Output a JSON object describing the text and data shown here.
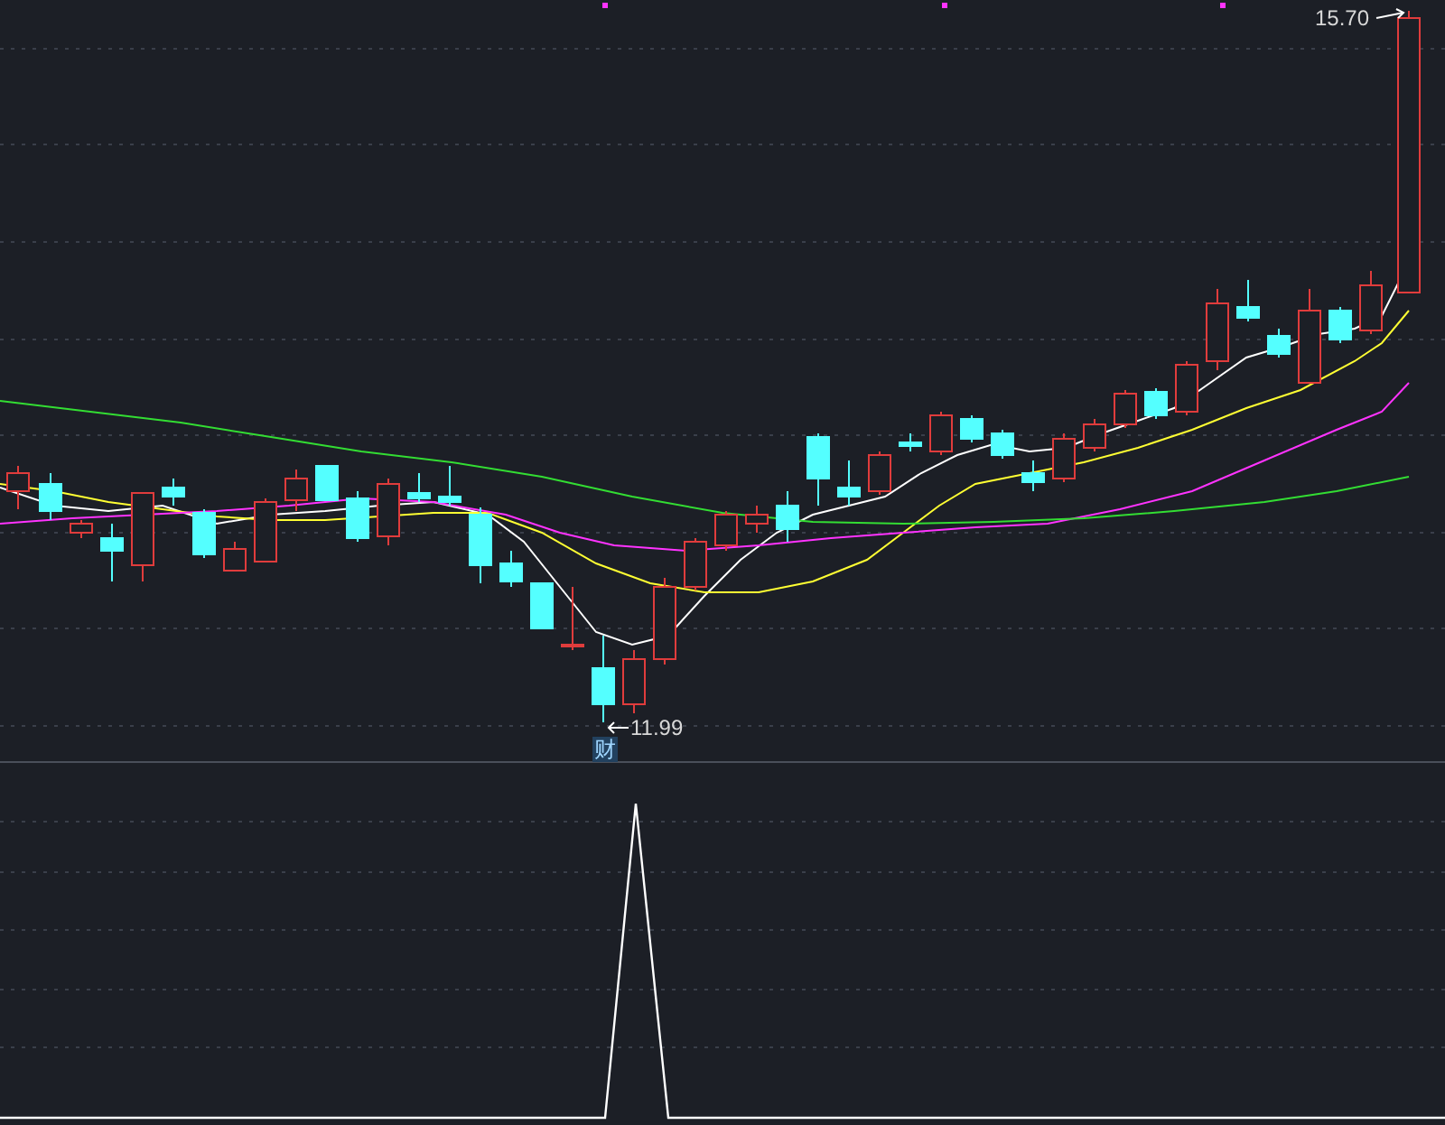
{
  "price_chart": {
    "high_label": "15.70",
    "low_label": "11.99",
    "event_marker": "财"
  }
}
